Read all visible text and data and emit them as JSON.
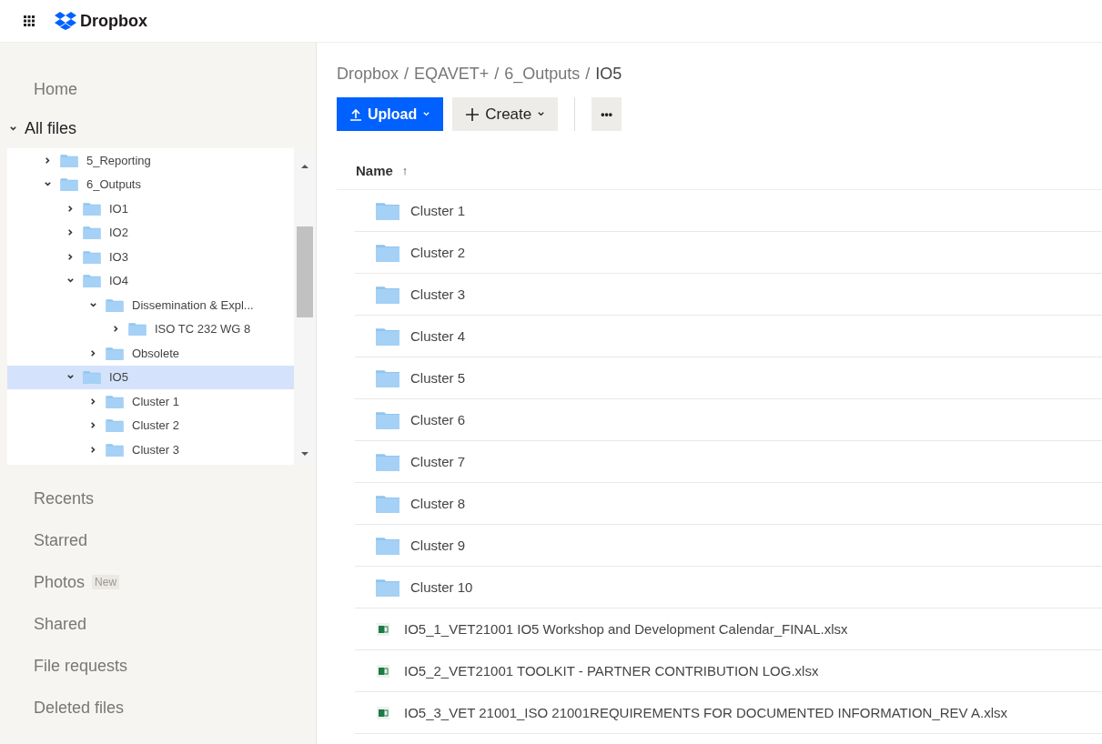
{
  "header": {
    "logo": "Dropbox"
  },
  "sidebar": {
    "top_items": [
      {
        "label": "Home",
        "kind": "link"
      },
      {
        "label": "All files",
        "expanded": true,
        "kind": "toggle"
      }
    ],
    "tree": [
      {
        "label": "5_Reporting",
        "expanded": false,
        "selected": false
      },
      {
        "label": "6_Outputs",
        "expanded": true,
        "selected": false,
        "children": [
          {
            "label": "IO1",
            "expanded": false,
            "selected": false
          },
          {
            "label": "IO2",
            "expanded": false,
            "selected": false
          },
          {
            "label": "IO3",
            "expanded": false,
            "selected": false
          },
          {
            "label": "IO4",
            "expanded": true,
            "selected": false,
            "children": [
              {
                "label": "Dissemination & Expl...",
                "expanded": true,
                "selected": false,
                "children": [
                  {
                    "label": "ISO TC 232 WG 8",
                    "expanded": false,
                    "selected": false
                  }
                ]
              },
              {
                "label": "Obsolete",
                "expanded": false,
                "selected": false
              }
            ]
          },
          {
            "label": "IO5",
            "expanded": true,
            "selected": true,
            "children": [
              {
                "label": "Cluster 1",
                "expanded": false,
                "selected": false
              },
              {
                "label": "Cluster 2",
                "expanded": false,
                "selected": false
              },
              {
                "label": "Cluster 3",
                "expanded": false,
                "selected": false
              }
            ]
          }
        ]
      }
    ],
    "items": [
      {
        "label": "Recents"
      },
      {
        "label": "Starred"
      },
      {
        "label": "Photos",
        "badge": "New"
      },
      {
        "label": "Shared"
      },
      {
        "label": "File requests"
      },
      {
        "label": "Deleted files"
      }
    ]
  },
  "main": {
    "breadcrumb": [
      "Dropbox",
      "/",
      "EQAVET+",
      "/",
      "6_Outputs",
      "/",
      "IO5"
    ],
    "buttons": [
      {
        "label": "Upload",
        "kind": "primary"
      },
      {
        "label": "Create",
        "kind": "secondary"
      },
      {
        "label": "•••",
        "kind": "more"
      }
    ],
    "table": {
      "column": "Name",
      "sort": "↑",
      "rows": [
        {
          "name": "Cluster 1",
          "kind": "folder"
        },
        {
          "name": "Cluster 2",
          "kind": "folder"
        },
        {
          "name": "Cluster 3",
          "kind": "folder"
        },
        {
          "name": "Cluster 4",
          "kind": "folder"
        },
        {
          "name": "Cluster 5",
          "kind": "folder"
        },
        {
          "name": "Cluster 6",
          "kind": "folder"
        },
        {
          "name": "Cluster 7",
          "kind": "folder"
        },
        {
          "name": "Cluster 8",
          "kind": "folder"
        },
        {
          "name": "Cluster 9",
          "kind": "folder"
        },
        {
          "name": "Cluster 10",
          "kind": "folder"
        },
        {
          "name": "IO5_1_VET21001 IO5 Workshop and Development Calendar_FINAL.xlsx",
          "kind": "spreadsheet"
        },
        {
          "name": "IO5_2_VET21001 TOOLKIT - PARTNER CONTRIBUTION LOG.xlsx",
          "kind": "spreadsheet"
        },
        {
          "name": "IO5_3_VET 21001_ISO 21001REQUIREMENTS FOR DOCUMENTED INFORMATION_REV A.xlsx",
          "kind": "spreadsheet"
        }
      ]
    }
  }
}
